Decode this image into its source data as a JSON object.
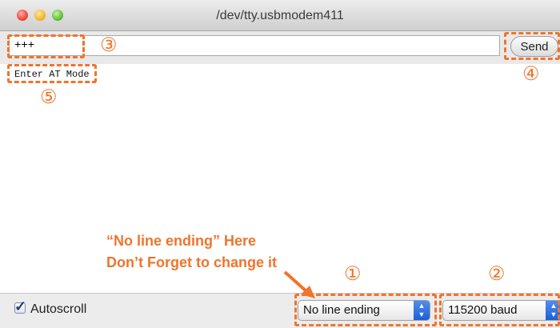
{
  "window": {
    "title": "/dev/tty.usbmodem411"
  },
  "input": {
    "value": "+++"
  },
  "send_button": {
    "label": "Send"
  },
  "output": {
    "line": "Enter AT Mode"
  },
  "footer": {
    "autoscroll_label": "Autoscroll",
    "autoscroll_checked": true,
    "line_ending": "No line ending",
    "baud_rate": "115200 baud"
  },
  "annotations": {
    "markers": [
      "①",
      "②",
      "③",
      "④",
      "⑤"
    ],
    "note_line1": "“No line ending” Here",
    "note_line2": "Don’t Forget to change it",
    "accent_color": "#f0742c"
  }
}
